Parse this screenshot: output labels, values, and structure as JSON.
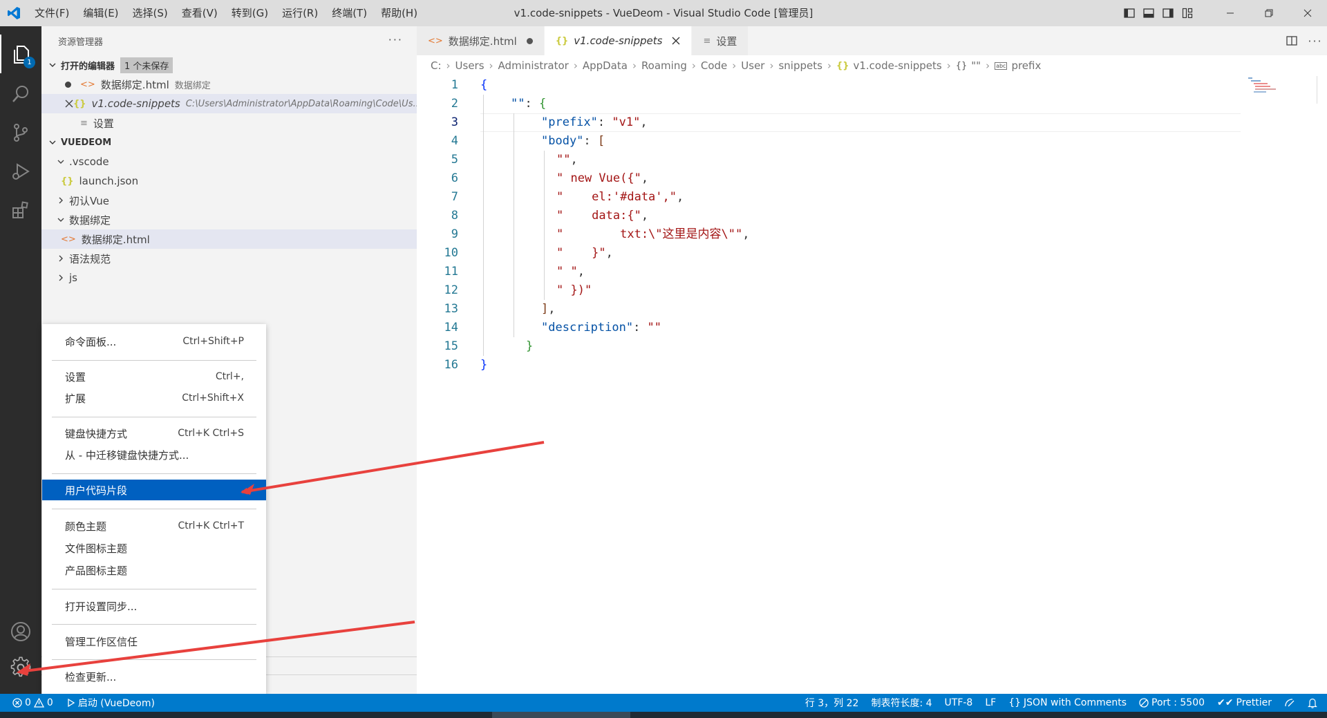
{
  "window": {
    "title": "v1.code-snippets - VueDeom - Visual Studio Code [管理员]"
  },
  "menubar": [
    "文件(F)",
    "编辑(E)",
    "选择(S)",
    "查看(V)",
    "转到(G)",
    "运行(R)",
    "终端(T)",
    "帮助(H)"
  ],
  "activity": {
    "explorer_badge": "1"
  },
  "sidebar": {
    "title": "资源管理器",
    "more": "···",
    "open_editors": {
      "label": "打开的编辑器",
      "unsaved": "1 个未保存",
      "items": [
        {
          "icon": "<>",
          "name": "数据绑定.html",
          "desc": "数据绑定"
        },
        {
          "icon": "{}",
          "name": "v1.code-snippets",
          "desc": "C:\\Users\\Administrator\\AppData\\Roaming\\Code\\Us..."
        },
        {
          "icon": "≡",
          "name": "设置",
          "desc": ""
        }
      ]
    },
    "workspace": {
      "label": "VUEDEOM",
      "items": [
        {
          "name": ".vscode"
        },
        {
          "name": "launch.json"
        },
        {
          "name": "初认Vue"
        },
        {
          "name": "数据绑定"
        },
        {
          "name": "数据绑定.html"
        },
        {
          "name": "语法规范"
        },
        {
          "name": "js"
        }
      ]
    }
  },
  "tabs": [
    {
      "icon": "<>",
      "label": "数据绑定.html"
    },
    {
      "icon": "{}",
      "label": "v1.code-snippets"
    },
    {
      "icon": "≡",
      "label": "设置"
    }
  ],
  "breadcrumb": [
    "C:",
    "Users",
    "Administrator",
    "AppData",
    "Roaming",
    "Code",
    "User",
    "snippets",
    "v1.code-snippets",
    "\"\"",
    "prefix"
  ],
  "breadcrumb_icons": {
    "json": "{}",
    "obj": "{}",
    "abc": "abc"
  },
  "code": {
    "lines": [
      "1",
      "2",
      "3",
      "4",
      "5",
      "6",
      "7",
      "8",
      "9",
      "10",
      "11",
      "12",
      "13",
      "14",
      "15",
      "16"
    ],
    "l1": "{",
    "l2_key": "\"\"",
    "l2_colon": ": ",
    "l2_brace": "{",
    "l3_key": "\"prefix\"",
    "l3_colon": ": ",
    "l3_val": "\"v1\"",
    "l3_comma": ",",
    "l4_key": "\"body\"",
    "l4_colon": ": ",
    "l4_bracket": "[",
    "l5": "\"\"",
    "l5_comma": ",",
    "l6": "\" new Vue({\"",
    "l6_comma": ",",
    "l7": "\"    el:'#data',\"",
    "l7_comma": ",",
    "l8": "\"    data:{\"",
    "l8_comma": ",",
    "l9": "\"        txt:\\\"这里是内容\\\"\"",
    "l9_comma": ",",
    "l10": "\"    }\"",
    "l10_comma": ",",
    "l11": "\" \"",
    "l11_comma": ",",
    "l12": "\" })\"",
    "l13_bracket": "]",
    "l13_comma": ",",
    "l14_key": "\"description\"",
    "l14_colon": ": ",
    "l14_val": "\"\"",
    "l15": "}",
    "l16": "}"
  },
  "context_menu": {
    "items": [
      {
        "label": "命令面板...",
        "kb": "Ctrl+Shift+P"
      },
      {
        "label": "设置",
        "kb": "Ctrl+,"
      },
      {
        "label": "扩展",
        "kb": "Ctrl+Shift+X"
      },
      {
        "label": "键盘快捷方式",
        "kb": "Ctrl+K Ctrl+S"
      },
      {
        "label": "从 - 中迁移键盘快捷方式...",
        "kb": ""
      },
      {
        "label": "用户代码片段",
        "kb": ""
      },
      {
        "label": "颜色主题",
        "kb": "Ctrl+K Ctrl+T"
      },
      {
        "label": "文件图标主题",
        "kb": ""
      },
      {
        "label": "产品图标主题",
        "kb": ""
      },
      {
        "label": "打开设置同步...",
        "kb": ""
      },
      {
        "label": "管理工作区信任",
        "kb": ""
      },
      {
        "label": "检查更新...",
        "kb": ""
      }
    ]
  },
  "statusbar": {
    "errors": "0",
    "warnings": "0",
    "launch": "启动 (VueDeom)",
    "position": "行 3，列 22",
    "tab_size": "制表符长度: 4",
    "encoding": "UTF-8",
    "eol": "LF",
    "language": "JSON with Comments",
    "port": "Port : 5500",
    "prettier": "Prettier"
  },
  "colors": {
    "accent": "#007acc",
    "menu_highlight": "#0060c0",
    "annotation_arrow": "#e8413d"
  }
}
